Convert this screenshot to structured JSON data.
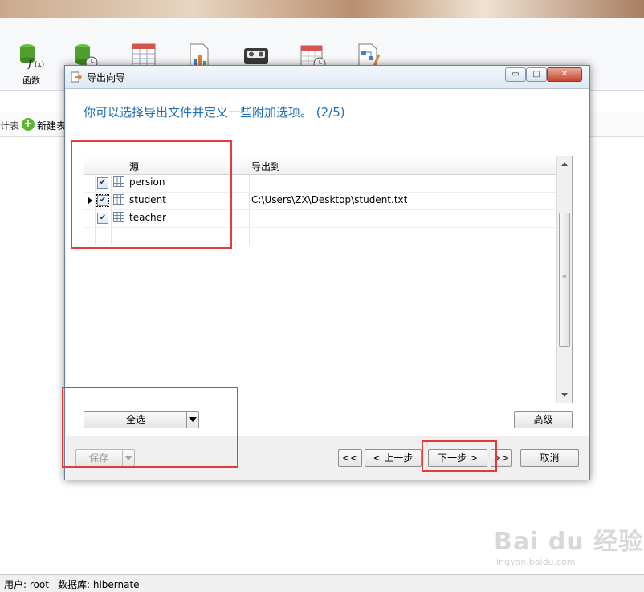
{
  "toolbar": {
    "functions_label": "函数"
  },
  "subbar": {
    "left_text": "计表",
    "new_table_label": "新建表"
  },
  "dialog": {
    "title": "导出向导",
    "heading": "你可以选择导出文件并定义一些附加选项。 (2/5)",
    "grid": {
      "col_source": "源",
      "col_export_to": "导出到",
      "rows": [
        {
          "name": "persion",
          "checked": true,
          "path": ""
        },
        {
          "name": "student",
          "checked": true,
          "path": "C:\\Users\\ZX\\Desktop\\student.txt",
          "current": true
        },
        {
          "name": "teacher",
          "checked": true,
          "path": ""
        }
      ]
    },
    "buttons": {
      "select_all": "全选",
      "advanced": "高级",
      "save": "保存",
      "first": "<<",
      "prev": "< 上一步",
      "next": "下一步 >",
      "last": ">>",
      "cancel": "取消"
    },
    "window_buttons": {
      "minimize": "▭",
      "maximize": "□",
      "close": "✕"
    }
  },
  "status": {
    "user": "用户: root",
    "database": "数据库: hibernate"
  },
  "watermark": {
    "logo": "Bai du 经验",
    "url": "jingyan.baidu.com"
  },
  "colors": {
    "heading_blue": "#1f6fb4",
    "highlight_red": "#e33b3b"
  }
}
